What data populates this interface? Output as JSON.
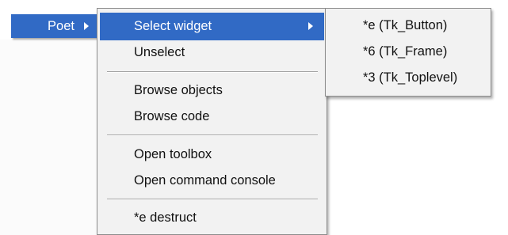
{
  "poet_menu": {
    "label": "Poet"
  },
  "context_menu": {
    "items": [
      {
        "label": "Select widget",
        "selected": true,
        "has_submenu": true
      },
      {
        "label": "Unselect"
      },
      {
        "label": "Browse objects"
      },
      {
        "label": "Browse code"
      },
      {
        "label": "Open toolbox"
      },
      {
        "label": "Open command console"
      },
      {
        "label": "*e destruct"
      }
    ]
  },
  "select_widget_submenu": {
    "items": [
      {
        "label": "*e (Tk_Button)"
      },
      {
        "label": "*6 (Tk_Frame)"
      },
      {
        "label": "*3 (Tk_Toplevel)"
      }
    ]
  },
  "colors": {
    "selection": "#316ac5",
    "menu_background": "#f2f2f2",
    "menu_border": "#8c8c8c",
    "text": "#111111",
    "selected_text": "#ffffff"
  },
  "icons": {
    "submenu_arrow": "chevron-right-icon"
  }
}
